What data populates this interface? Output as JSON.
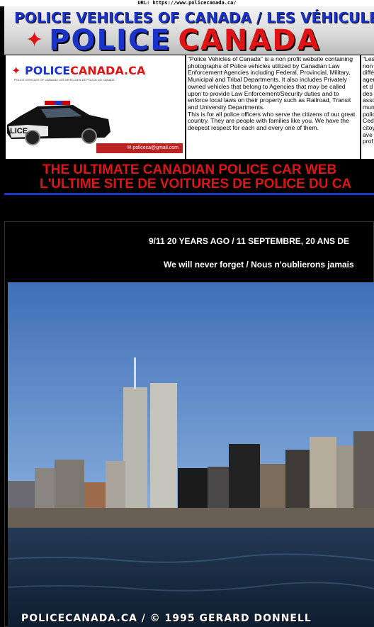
{
  "url_bar": {
    "text": "URL: https://www.policecanada.ca/"
  },
  "banner": {
    "title": "POLICE VEHICLES OF CANADA / LES VÉHICULES DE",
    "logo_word1": "POLICE",
    "logo_word2": "CANADA"
  },
  "card_left": {
    "logo_word1": "POLICE",
    "logo_word2": "CANADA.CA",
    "logo_sub": "POLICE VEHICLES OF CANADA / LES VÉHICULES DE POLICE DU CANADA",
    "car_text": "LICE",
    "email": "policeca@gmail.com"
  },
  "card_mid": {
    "para1": "\"Police Vehicles of Canada\" is a non profit website containing photographs of Police vehicles utilized by Canadian Law Enforcement Agencies including Federal, Provincial, Military, Municipal and Tribal Departments. It also includes Privately owned vehicles that belong to Agencies that may be called upon to provide Law Enforcement/Security duties and to enforce local laws on their property such as Railroad, Transit and University Departments.",
    "para2": "This is for all police officers who serve the citizens of our great country. They are people with families like you. We have the deepest respect for each and every one of them."
  },
  "card_right": {
    "lines": [
      "\"Les",
      "non",
      "diffé",
      "agen",
      "et d",
      "des",
      "asso",
      "mun",
      "polic",
      "Ced",
      "citoy",
      "ave",
      "prof"
    ]
  },
  "headline": {
    "line1": "THE ULTIMATE CANADIAN POLICE CAR WEB",
    "line2": "L'ULTIME SITE DE VOITURES DE POLICE DU CA"
  },
  "tribute": {
    "title": "9/11 20 YEARS AGO / 11 SEPTEMBRE, 20 ANS DE",
    "subtitle": "We will never forget / Nous n'oublierons jamais",
    "credit": "POLICECANADA.CA / © 1995 GERARD DONNELL"
  },
  "colors": {
    "brand_blue": "#1a33c8",
    "brand_red": "#e01414",
    "background": "#000000"
  },
  "icons": [
    "maple-leaf-icon",
    "police-car-image",
    "nyc-skyline-photo"
  ]
}
